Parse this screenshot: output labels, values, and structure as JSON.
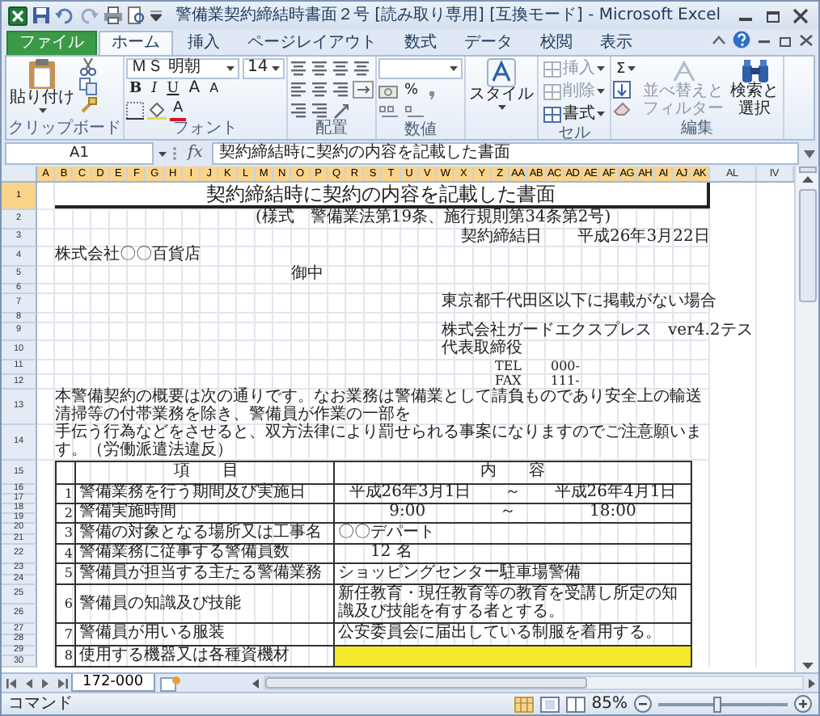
{
  "window": {
    "title": "警備業契約締結時書面２号 [読み取り専用] [互換モード] - Microsoft Excel"
  },
  "ribbon": {
    "tabs": [
      {
        "label": "ファイル",
        "kind": "file",
        "selected": false
      },
      {
        "label": "ホーム",
        "kind": "tab",
        "selected": true
      },
      {
        "label": "挿入",
        "kind": "tab",
        "selected": false
      },
      {
        "label": "ページレイアウト",
        "kind": "tab",
        "selected": false
      },
      {
        "label": "数式",
        "kind": "tab",
        "selected": false
      },
      {
        "label": "データ",
        "kind": "tab",
        "selected": false
      },
      {
        "label": "校閲",
        "kind": "tab",
        "selected": false
      },
      {
        "label": "表示",
        "kind": "tab",
        "selected": false
      }
    ],
    "groups": [
      {
        "kind": "clipboard",
        "label": "クリップボード",
        "paste": "貼り付け"
      },
      {
        "kind": "font",
        "label": "フォント",
        "font": "ＭＳ 明朝",
        "size": "14",
        "styles": [
          "B",
          "I",
          "U"
        ],
        "grow": "A",
        "shrink": "A",
        "font_color": "A"
      },
      {
        "kind": "alignment",
        "label": "配置"
      },
      {
        "kind": "number",
        "label": "数値",
        "percent": "%"
      },
      {
        "kind": "styles",
        "button": "スタイル"
      },
      {
        "kind": "cells",
        "label": "セル",
        "commands": [
          {
            "label": "挿入",
            "disabled": true
          },
          {
            "label": "削除",
            "disabled": true
          },
          {
            "label": "書式",
            "disabled": false
          }
        ]
      },
      {
        "kind": "editing",
        "label": "編集",
        "sum": "Σ",
        "sort": {
          "lines": [
            "並べ替えと",
            "フィルター"
          ],
          "disabled": true
        },
        "find": {
          "lines": [
            "検索と",
            "選択"
          ],
          "disabled": false
        }
      }
    ]
  },
  "formula_bar": {
    "name_box": "A1",
    "fx": "fx",
    "value": "契約締結時に契約の内容を記載した書面"
  },
  "sheet": {
    "columns": [
      {
        "label": "A",
        "selected": true
      },
      {
        "label": "B",
        "selected": true
      },
      {
        "label": "C",
        "selected": true
      },
      {
        "label": "D",
        "selected": true
      },
      {
        "label": "E",
        "selected": true
      },
      {
        "label": "F",
        "selected": true
      },
      {
        "label": "G",
        "selected": true
      },
      {
        "label": "H",
        "selected": true
      },
      {
        "label": "I",
        "selected": true
      },
      {
        "label": "J",
        "selected": true
      },
      {
        "label": "K",
        "selected": true
      },
      {
        "label": "L",
        "selected": true
      },
      {
        "label": "M",
        "selected": true
      },
      {
        "label": "N",
        "selected": true
      },
      {
        "label": "O",
        "selected": true
      },
      {
        "label": "P",
        "selected": true
      },
      {
        "label": "Q",
        "selected": true
      },
      {
        "label": "R",
        "selected": true
      },
      {
        "label": "S",
        "selected": true
      },
      {
        "label": "T",
        "selected": true
      },
      {
        "label": "U",
        "selected": true
      },
      {
        "label": "V",
        "selected": true
      },
      {
        "label": "W",
        "selected": true
      },
      {
        "label": "X",
        "selected": true
      },
      {
        "label": "Y",
        "selected": true
      },
      {
        "label": "Z",
        "selected": true
      },
      {
        "label": "AA",
        "selected": true
      },
      {
        "label": "AB",
        "selected": true
      },
      {
        "label": "AC",
        "selected": true
      },
      {
        "label": "AD",
        "selected": true
      },
      {
        "label": "AE",
        "selected": true
      },
      {
        "label": "AF",
        "selected": true
      },
      {
        "label": "AG",
        "selected": true
      },
      {
        "label": "AH",
        "selected": true
      },
      {
        "label": "AI",
        "selected": true
      },
      {
        "label": "AJ",
        "selected": true
      },
      {
        "label": "AK",
        "selected": true
      },
      {
        "label": "AL",
        "selected": false
      },
      {
        "label": "IV",
        "selected": false
      }
    ],
    "rows": [
      {
        "label": "1",
        "selected": true
      },
      {
        "label": "2",
        "selected": false
      },
      {
        "label": "3",
        "selected": false
      },
      {
        "label": "4",
        "selected": false
      },
      {
        "label": "5",
        "selected": false
      },
      {
        "label": "6",
        "selected": false
      },
      {
        "label": "7",
        "selected": false
      },
      {
        "label": "8",
        "selected": false
      },
      {
        "label": "9",
        "selected": false
      },
      {
        "label": "10",
        "selected": false
      },
      {
        "label": "11",
        "selected": false
      },
      {
        "label": "12",
        "selected": false
      },
      {
        "label": "13",
        "selected": false
      },
      {
        "label": "14",
        "selected": false
      },
      {
        "label": "15",
        "selected": false
      },
      {
        "label": "16",
        "selected": false
      },
      {
        "label": "17",
        "selected": false
      },
      {
        "label": "18",
        "selected": false
      },
      {
        "label": "19",
        "selected": false
      },
      {
        "label": "20",
        "selected": false
      },
      {
        "label": "21",
        "selected": false
      },
      {
        "label": "22",
        "selected": false
      },
      {
        "label": "23",
        "selected": false
      },
      {
        "label": "24",
        "selected": false
      },
      {
        "label": "25",
        "selected": false
      },
      {
        "label": "26",
        "selected": false
      },
      {
        "label": "27",
        "selected": false
      },
      {
        "label": "28",
        "selected": false
      },
      {
        "label": "29",
        "selected": false
      },
      {
        "label": "30",
        "selected": false
      }
    ],
    "title": "契約締結時に契約の内容を記載した書面",
    "subtitle": "(様式　警備業法第19条、施行規則第34条第2号)",
    "contract_date_label": "契約締結日",
    "contract_date": "平成26年3月22日",
    "client": "株式会社〇〇百貨店",
    "honorific": "御中",
    "address": "東京都千代田区以下に掲載がない場合",
    "company": "株式会社ガードエクスプレス　ver4.2テス",
    "representative": "代表取締役",
    "tel_label": "TEL",
    "tel": "000-",
    "fax_label": "FAX",
    "fax": "111-",
    "notice": [
      "本警備契約の概要は次の通りです。なお業務は警備業として請負ものであり安全上の輸送清掃等の付帯業務を除き、警備員が作業の一部を",
      "手伝う行為などをさせると、双方法律により罰せられる事案になりますのでご注意願います。（労働派遣法違反）"
    ],
    "table": {
      "header": [
        "項　　目",
        "内　　容"
      ],
      "items": [
        {
          "number": "1",
          "label": "警備業務を行う期間及び実施日",
          "content": {
            "kind": "range",
            "start": "平成26年3月1日",
            "separator": "～",
            "end": "平成26年4月1日"
          },
          "highlighted": false
        },
        {
          "number": "2",
          "label": "警備実施時間",
          "content": {
            "kind": "range",
            "start": "9:00",
            "separator": "～",
            "end": "18:00"
          },
          "highlighted": false
        },
        {
          "number": "3",
          "label": "警備の対象となる場所又は工事名",
          "content": {
            "kind": "text",
            "text": "〇〇デパート"
          },
          "highlighted": false
        },
        {
          "number": "4",
          "label": "警備業務に従事する警備員数",
          "content": {
            "kind": "count",
            "text": "12 名"
          },
          "highlighted": false
        },
        {
          "number": "5",
          "label": "警備員が担当する主たる警備業務",
          "content": {
            "kind": "text",
            "text": "ショッピングセンター駐車場警備"
          },
          "highlighted": false
        },
        {
          "number": "6",
          "label": "警備員の知識及び技能",
          "content": {
            "kind": "text",
            "text": "新任教育・現任教育等の教育を受講し所定の知識及び技能を有する者とする。"
          },
          "highlighted": false
        },
        {
          "number": "7",
          "label": "警備員が用いる服装",
          "content": {
            "kind": "text",
            "text": "公安委員会に届出している制服を着用する。"
          },
          "highlighted": false
        },
        {
          "number": "8",
          "label": "使用する機器又は各種資機材",
          "content": {
            "kind": "blank"
          },
          "highlighted": true
        }
      ]
    }
  },
  "sheet_tabs": [
    {
      "label": "172-000",
      "selected": true
    }
  ],
  "status_bar": {
    "mode": "コマンド",
    "zoom": "85%",
    "zoom_slider": {
      "level": 0.45
    }
  }
}
